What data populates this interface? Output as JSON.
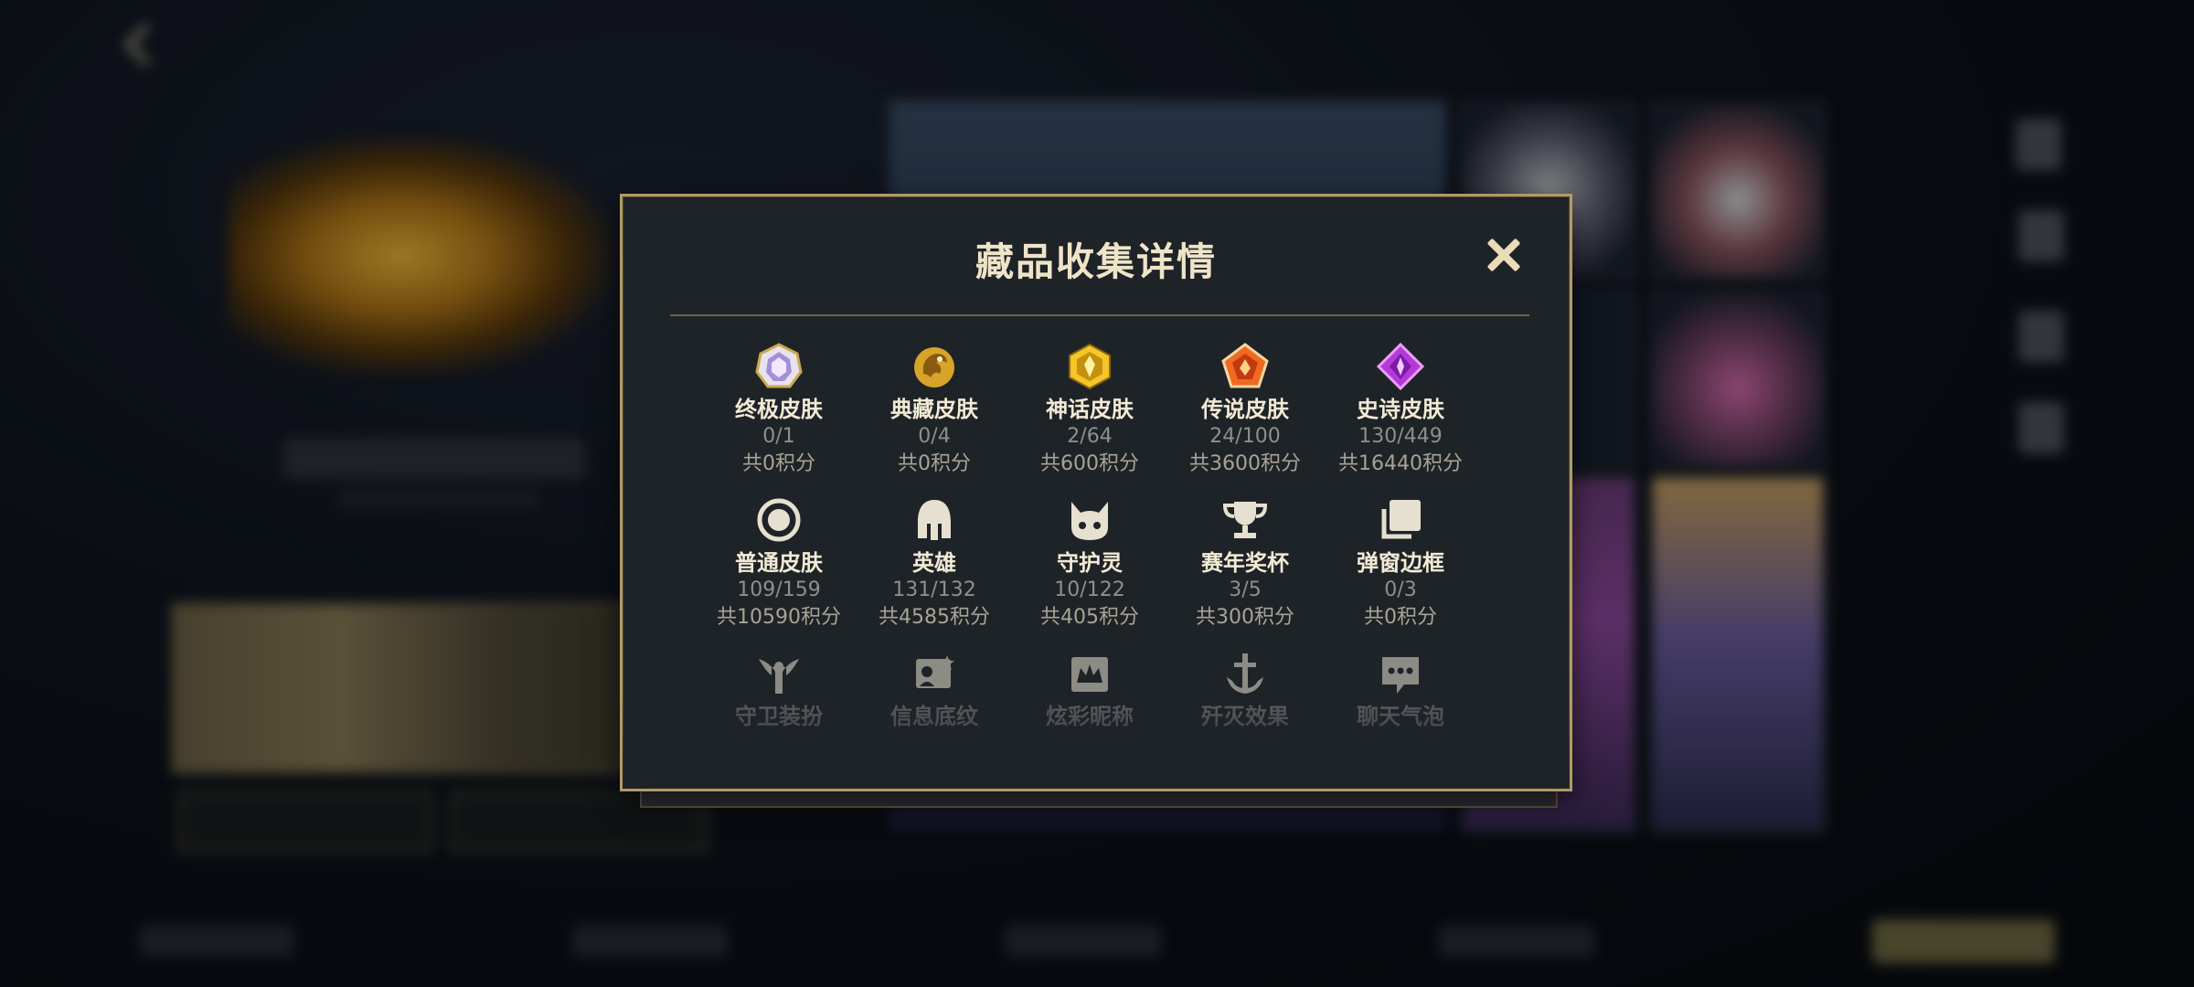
{
  "modal": {
    "title": "藏品收集详情",
    "items": [
      {
        "name": "终极皮肤",
        "count": "0/1",
        "points": "共0积分",
        "icon": "ultimate-skin-icon"
      },
      {
        "name": "典藏皮肤",
        "count": "0/4",
        "points": "共0积分",
        "icon": "collector-skin-icon"
      },
      {
        "name": "神话皮肤",
        "count": "2/64",
        "points": "共600积分",
        "icon": "mythic-skin-icon"
      },
      {
        "name": "传说皮肤",
        "count": "24/100",
        "points": "共3600积分",
        "icon": "legendary-skin-icon"
      },
      {
        "name": "史诗皮肤",
        "count": "130/449",
        "points": "共16440积分",
        "icon": "epic-skin-icon"
      },
      {
        "name": "普通皮肤",
        "count": "109/159",
        "points": "共10590积分",
        "icon": "normal-skin-icon"
      },
      {
        "name": "英雄",
        "count": "131/132",
        "points": "共4585积分",
        "icon": "helmet-icon"
      },
      {
        "name": "守护灵",
        "count": "10/122",
        "points": "共405积分",
        "icon": "guardian-spirit-icon"
      },
      {
        "name": "赛年奖杯",
        "count": "3/5",
        "points": "共300积分",
        "icon": "trophy-icon"
      },
      {
        "name": "弹窗边框",
        "count": "0/3",
        "points": "共0积分",
        "icon": "frame-icon"
      },
      {
        "name": "守卫装扮",
        "icon": "ward-skin-icon"
      },
      {
        "name": "信息底纹",
        "icon": "banner-icon"
      },
      {
        "name": "炫彩昵称",
        "icon": "nickname-icon"
      },
      {
        "name": "歼灭效果",
        "icon": "anchor-icon"
      },
      {
        "name": "聊天气泡",
        "icon": "chat-bubble-icon"
      }
    ]
  },
  "colors": {
    "modal_bg": "#1e2328",
    "modal_border": "#b19a66",
    "title": "#efe4c8",
    "count": "#8f8f8a"
  }
}
